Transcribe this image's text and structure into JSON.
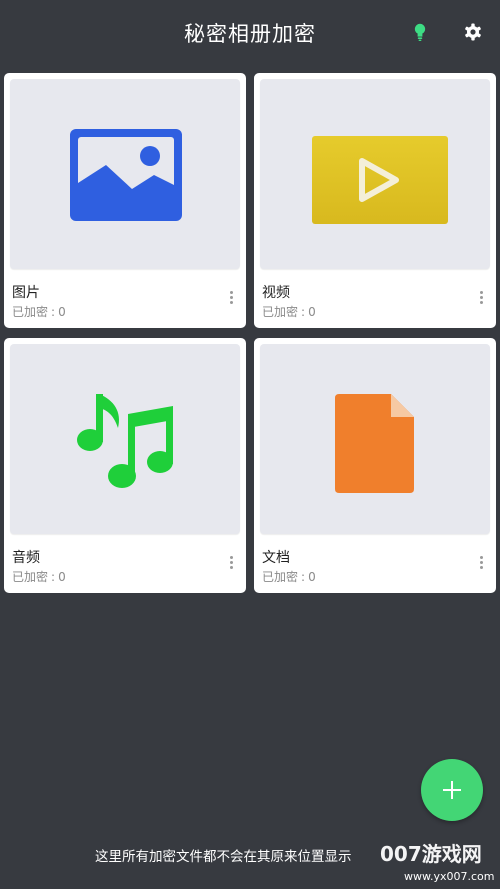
{
  "app": {
    "title": "秘密相册加密"
  },
  "toolbar": {
    "bulb_icon": "lightbulb-icon",
    "settings_icon": "gear-icon",
    "bulb_color": "#3ddc84"
  },
  "categories": [
    {
      "title": "图片",
      "count_label": "已加密",
      "count": "0",
      "icon": "image-icon",
      "color": "#2f5fe0"
    },
    {
      "title": "视频",
      "count_label": "已加密",
      "count": "0",
      "icon": "video-icon",
      "color": "#e0c424"
    },
    {
      "title": "音频",
      "count_label": "已加密",
      "count": "0",
      "icon": "music-icon",
      "color": "#1fcf3a"
    },
    {
      "title": "文档",
      "count_label": "已加密",
      "count": "0",
      "icon": "document-icon",
      "color": "#f07f2c"
    }
  ],
  "fab": {
    "icon": "plus-icon",
    "color": "#43d675"
  },
  "footer": {
    "text": "这里所有加密文件都不会在其原来位置显示"
  },
  "watermark": {
    "text": "007游戏网",
    "url": "www.yx007.com"
  }
}
